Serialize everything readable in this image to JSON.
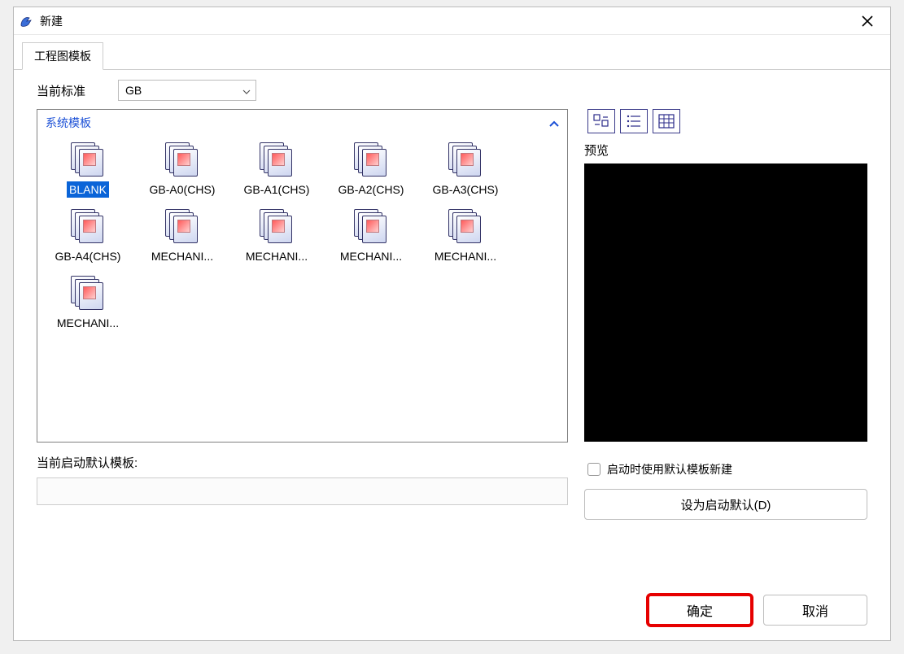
{
  "title": "新建",
  "tab_label": "工程图模板",
  "standard_label": "当前标准",
  "standard_value": "GB",
  "group_header": "系统模板",
  "templates": [
    {
      "label": "BLANK",
      "selected": true
    },
    {
      "label": "GB-A0(CHS)",
      "selected": false
    },
    {
      "label": "GB-A1(CHS)",
      "selected": false
    },
    {
      "label": "GB-A2(CHS)",
      "selected": false
    },
    {
      "label": "GB-A3(CHS)",
      "selected": false
    },
    {
      "label": "GB-A4(CHS)",
      "selected": false
    },
    {
      "label": "MECHANI...",
      "selected": false
    },
    {
      "label": "MECHANI...",
      "selected": false
    },
    {
      "label": "MECHANI...",
      "selected": false
    },
    {
      "label": "MECHANI...",
      "selected": false
    },
    {
      "label": "MECHANI...",
      "selected": false
    }
  ],
  "default_template_label": "当前启动默认模板:",
  "default_template_path": "",
  "preview_label": "预览",
  "use_default_on_start": "启动时使用默认模板新建",
  "set_default_label": "设为启动默认(D)",
  "ok_label": "确定",
  "cancel_label": "取消"
}
